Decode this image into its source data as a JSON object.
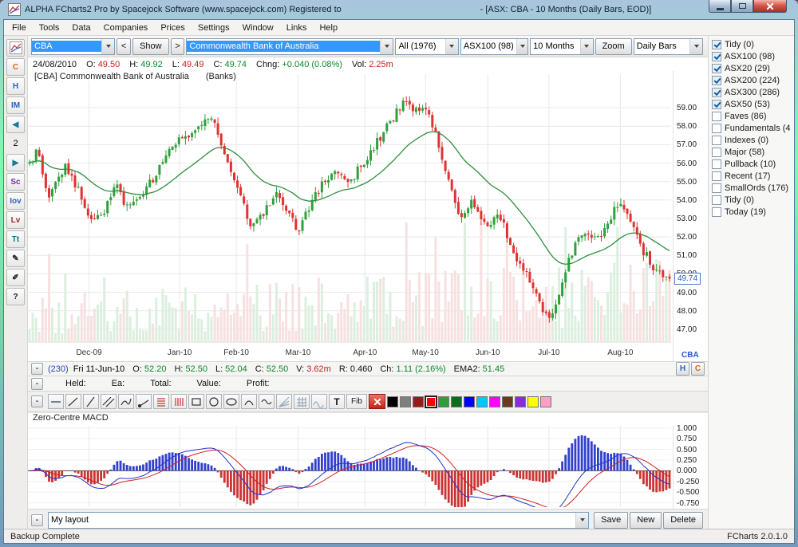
{
  "window": {
    "title_left": "ALPHA FCharts2 Pro by Spacejock Software (www.spacejock.com) Registered to",
    "title_right": "- [ASX: CBA - 10 Months (Daily Bars, EOD)]"
  },
  "menu": {
    "items": [
      "File",
      "Tools",
      "Data",
      "Companies",
      "Prices",
      "Settings",
      "Window",
      "Links",
      "Help"
    ]
  },
  "toolbar": {
    "symbol_value": "CBA",
    "prev_label": "<",
    "show_label": "Show",
    "next_label": ">",
    "company_value": "Commonwealth Bank of Australia",
    "group_value": "All (1976)",
    "index_value": "ASX100 (98)",
    "period_value": "10 Months",
    "zoom_label": "Zoom",
    "bars_value": "Daily Bars"
  },
  "sidebar": {
    "items": [
      {
        "name": "mini-chart",
        "kind": "chart"
      },
      {
        "name": "contracts",
        "glyph": "C",
        "color": "#d2691e"
      },
      {
        "name": "highlight",
        "glyph": "H",
        "color": "#2b5fc0"
      },
      {
        "name": "intraday",
        "glyph": "IM",
        "color": "#2b5fc0"
      },
      {
        "name": "prev-stock",
        "glyph": "◀",
        "color": "#1a7a9a"
      },
      {
        "name": "stock-count",
        "glyph": "2",
        "color": "#000000",
        "plain": true
      },
      {
        "name": "next-stock",
        "glyph": "▶",
        "color": "#1a7a9a"
      },
      {
        "name": "scanner",
        "glyph": "Sc",
        "color": "#7a2fa8"
      },
      {
        "name": "indicators",
        "glyph": "Iov",
        "color": "#2b5fc0"
      },
      {
        "name": "levels",
        "glyph": "Lv",
        "color": "#9a3030"
      },
      {
        "name": "text-notes",
        "glyph": "Tt",
        "color": "#117788"
      },
      {
        "name": "pencil",
        "glyph": "✎",
        "color": "#222222"
      },
      {
        "name": "draw-wand",
        "glyph": "✐",
        "color": "#222222"
      },
      {
        "name": "help",
        "glyph": "?",
        "color": "#222222"
      }
    ]
  },
  "quote": {
    "date": "24/08/2010",
    "items": [
      {
        "label": "O:",
        "value": "49.50",
        "color": "red"
      },
      {
        "label": "H:",
        "value": "49.92",
        "color": "green"
      },
      {
        "label": "L:",
        "value": "49.49",
        "color": "red"
      },
      {
        "label": "C:",
        "value": "49.74",
        "color": "green"
      },
      {
        "label": "Chng:",
        "value": "+0.040 (0.08%)",
        "color": "green"
      },
      {
        "label": "Vol:",
        "value": "2.25m",
        "color": "red"
      }
    ]
  },
  "chart_header": {
    "code": "[CBA] Commonwealth Bank of Australia",
    "sector": "(Banks)"
  },
  "watchlist": {
    "items": [
      {
        "label": "Tidy (0)",
        "checked": true
      },
      {
        "label": "ASX100 (98)",
        "checked": true
      },
      {
        "label": "ASX20 (29)",
        "checked": true
      },
      {
        "label": "ASX200 (224)",
        "checked": true
      },
      {
        "label": "ASX300 (286)",
        "checked": true
      },
      {
        "label": "ASX50 (53)",
        "checked": true
      },
      {
        "label": "Faves (86)",
        "checked": false
      },
      {
        "label": "Fundamentals (4",
        "checked": false
      },
      {
        "label": "Indexes (0)",
        "checked": false
      },
      {
        "label": "Major (58)",
        "checked": false
      },
      {
        "label": "Pullback (10)",
        "checked": false
      },
      {
        "label": "Recent (17)",
        "checked": false
      },
      {
        "label": "SmallOrds (176)",
        "checked": false
      },
      {
        "label": "Tidy (0)",
        "checked": false
      },
      {
        "label": "Today (19)",
        "checked": false
      }
    ]
  },
  "status_line": {
    "bar_no": "(230)",
    "date": "Fri 11-Jun-10",
    "items": [
      {
        "label": "O:",
        "value": "52.20",
        "color": "green"
      },
      {
        "label": "H:",
        "value": "52.50",
        "color": "green"
      },
      {
        "label": "L:",
        "value": "52.04",
        "color": "green"
      },
      {
        "label": "C:",
        "value": "52.50",
        "color": "green"
      },
      {
        "label": "V:",
        "value": "3.62m",
        "color": "red"
      },
      {
        "label": "R:",
        "value": "0.460",
        "color": "black"
      },
      {
        "label": "Ch:",
        "value": "1.11 (2.16%)",
        "color": "green"
      },
      {
        "label": "EMA2:",
        "value": "51.45",
        "color": "green"
      }
    ],
    "h_btn": "H",
    "c_btn": "C"
  },
  "position_line": {
    "items": [
      "Held:",
      "Ea:",
      "Total:",
      "Value:",
      "Profit:"
    ]
  },
  "draw_toolbar": {
    "text_label": "T",
    "fib_label": "Fib",
    "tools": [
      "hline",
      "diag1",
      "diag2",
      "ddouble",
      "freehand",
      "ray",
      "hatch-h",
      "hatch-v",
      "rect",
      "circle",
      "ellipse",
      "arc",
      "wave",
      "fan",
      "grid",
      "cycle"
    ],
    "swatches": [
      "#000000",
      "#7f7f7f",
      "#9a1a1a",
      "#ff0000",
      "#2d9e3a",
      "#0c6b1d",
      "#0000ff",
      "#00c8ff",
      "#ff00ff",
      "#6b3b1f",
      "#8a2be2",
      "#ffff00",
      "#ff9ecb"
    ],
    "selected_swatch": 3
  },
  "macd": {
    "title": "Zero-Centre MACD",
    "y_ticks": [
      "1.000",
      "0.750",
      "0.500",
      "0.250",
      "0.000",
      "-0.250",
      "-0.500",
      "-0.750"
    ]
  },
  "layout_bar": {
    "layout_value": "My layout",
    "save_label": "Save",
    "new_label": "New",
    "delete_label": "Delete"
  },
  "status_bar": {
    "left": "Backup Complete",
    "right": "FCharts 2.0.1.0"
  },
  "ui": {
    "collapse_label": "-"
  },
  "chart_data": {
    "type": "candlestick",
    "symbol": "CBA",
    "title": "[CBA] Commonwealth Bank of Australia (Banks)",
    "bars": 198,
    "price_range": [
      46.3,
      60.3
    ],
    "price_ticks": [
      "59.00",
      "58.00",
      "57.00",
      "56.00",
      "55.00",
      "54.00",
      "53.00",
      "52.00",
      "51.00",
      "50.00",
      "49.00",
      "48.00",
      "47.00"
    ],
    "x_ticks": [
      {
        "label": "Dec-09",
        "t": 0.095
      },
      {
        "label": "Jan-10",
        "t": 0.236
      },
      {
        "label": "Feb-10",
        "t": 0.324
      },
      {
        "label": "Mar-10",
        "t": 0.42
      },
      {
        "label": "Apr-10",
        "t": 0.524
      },
      {
        "label": "May-10",
        "t": 0.618
      },
      {
        "label": "Jun-10",
        "t": 0.715
      },
      {
        "label": "Jul-10",
        "t": 0.81
      },
      {
        "label": "Aug-10",
        "t": 0.921
      }
    ],
    "axis_symbol": "CBA",
    "last_price": "49.74",
    "ma_period": 28,
    "price_path": [
      [
        0.0,
        56.0
      ],
      [
        0.012,
        56.6
      ],
      [
        0.03,
        54.2
      ],
      [
        0.055,
        55.8
      ],
      [
        0.075,
        54.6
      ],
      [
        0.095,
        52.9
      ],
      [
        0.115,
        53.3
      ],
      [
        0.135,
        54.9
      ],
      [
        0.155,
        53.4
      ],
      [
        0.175,
        54.3
      ],
      [
        0.195,
        55.2
      ],
      [
        0.22,
        56.8
      ],
      [
        0.25,
        57.6
      ],
      [
        0.285,
        58.4
      ],
      [
        0.305,
        56.6
      ],
      [
        0.324,
        54.8
      ],
      [
        0.345,
        52.6
      ],
      [
        0.365,
        53.2
      ],
      [
        0.385,
        54.3
      ],
      [
        0.4,
        53.6
      ],
      [
        0.42,
        52.2
      ],
      [
        0.44,
        53.8
      ],
      [
        0.46,
        55.0
      ],
      [
        0.48,
        55.4
      ],
      [
        0.5,
        54.9
      ],
      [
        0.524,
        56.2
      ],
      [
        0.545,
        57.2
      ],
      [
        0.565,
        58.3
      ],
      [
        0.588,
        59.6
      ],
      [
        0.6,
        58.7
      ],
      [
        0.618,
        59.2
      ],
      [
        0.635,
        57.4
      ],
      [
        0.655,
        55.2
      ],
      [
        0.672,
        52.8
      ],
      [
        0.69,
        53.9
      ],
      [
        0.715,
        52.6
      ],
      [
        0.735,
        53.2
      ],
      [
        0.755,
        51.2
      ],
      [
        0.775,
        50.1
      ],
      [
        0.795,
        48.6
      ],
      [
        0.812,
        47.4
      ],
      [
        0.83,
        49.3
      ],
      [
        0.85,
        51.4
      ],
      [
        0.868,
        52.4
      ],
      [
        0.885,
        51.8
      ],
      [
        0.905,
        52.9
      ],
      [
        0.921,
        53.9
      ],
      [
        0.94,
        52.6
      ],
      [
        0.96,
        51.2
      ],
      [
        0.98,
        50.0
      ],
      [
        1.0,
        49.74
      ]
    ],
    "macd": {
      "fast": 12,
      "slow": 26,
      "signal": 9
    }
  }
}
